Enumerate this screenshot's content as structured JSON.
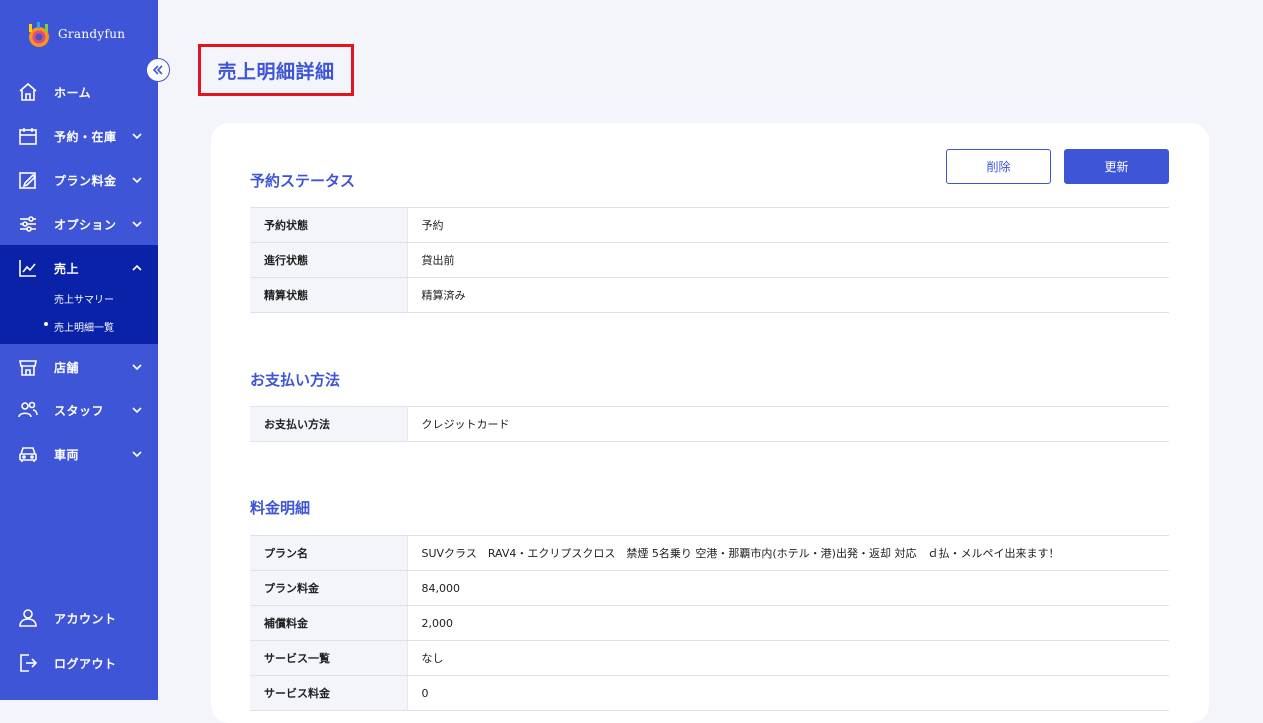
{
  "app": {
    "logo_text": "Grandyfun"
  },
  "sidebar": {
    "items": [
      {
        "label": "ホーム",
        "icon": "home-icon"
      },
      {
        "label": "予約・在庫",
        "icon": "calendar-icon"
      },
      {
        "label": "プラン料金",
        "icon": "edit-icon"
      },
      {
        "label": "オプション",
        "icon": "sliders-icon"
      },
      {
        "label": "売上",
        "icon": "chart-line-icon"
      },
      {
        "label": "店舗",
        "icon": "store-icon"
      },
      {
        "label": "スタッフ",
        "icon": "users-icon"
      },
      {
        "label": "車両",
        "icon": "car-icon"
      }
    ],
    "sales_sub": [
      {
        "label": "売上サマリー"
      },
      {
        "label": "売上明細一覧"
      }
    ],
    "account_label": "アカウント",
    "logout_label": "ログアウト"
  },
  "page": {
    "title": "売上明細詳細",
    "delete_label": "削除",
    "update_label": "更新"
  },
  "sections": {
    "reservation": {
      "title": "予約ステータス",
      "rows": [
        {
          "key": "予約状態",
          "value": "予約"
        },
        {
          "key": "進行状態",
          "value": "貸出前"
        },
        {
          "key": "精算状態",
          "value": "精算済み"
        }
      ]
    },
    "payment": {
      "title": "お支払い方法",
      "rows": [
        {
          "key": "お支払い方法",
          "value": "クレジットカード"
        }
      ]
    },
    "fees": {
      "title": "料金明細",
      "rows": [
        {
          "key": "プラン名",
          "value": "SUVクラス　RAV4・エクリプスクロス　禁煙 5名乗り 空港・那覇市内(ホテル・港)出発・返却 対応　ｄ払・メルペイ出来ます！"
        },
        {
          "key": "プラン料金",
          "value": "84,000"
        },
        {
          "key": "補償料金",
          "value": "2,000"
        },
        {
          "key": "サービス一覧",
          "value": "なし"
        },
        {
          "key": "サービス料金",
          "value": "0"
        }
      ]
    }
  },
  "colors": {
    "sidebar": "#3d55d6",
    "sidebar_active": "#0a22a8",
    "accent": "#3d55d6",
    "highlight_border": "#e3141c",
    "background": "#f3f5fb"
  }
}
